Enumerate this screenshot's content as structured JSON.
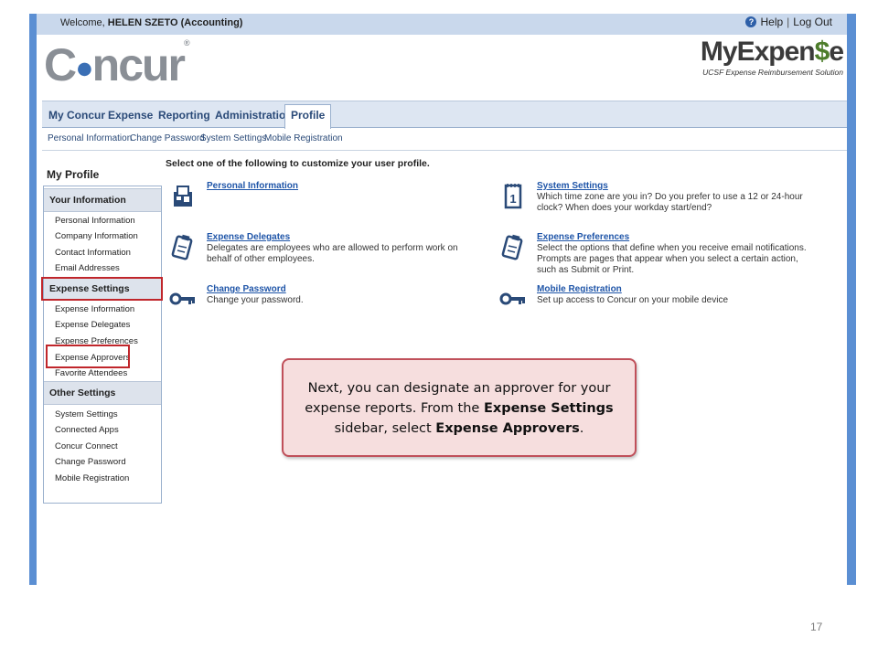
{
  "header": {
    "welcome_prefix": "Welcome,",
    "welcome_user": "HELEN SZETO (Accounting)",
    "help": "Help",
    "logout": "Log Out"
  },
  "logo": {
    "name": "C",
    "name_rest": "ncur"
  },
  "brand": {
    "title_a": "MyExpen",
    "title_s": "$",
    "title_b": "e",
    "subtitle": "UCSF Expense Reimbursement Solution"
  },
  "nav": {
    "tabs": [
      "My Concur",
      "Expense",
      "Reporting",
      "Administration",
      "Profile"
    ],
    "active": "Profile"
  },
  "subnav": [
    "Personal Information",
    "Change Password",
    "System Settings",
    "Mobile Registration"
  ],
  "sidebar": {
    "title": "My Profile",
    "sections": [
      {
        "heading": "Your Information",
        "items": [
          "Personal Information",
          "Company Information",
          "Contact Information",
          "Email Addresses"
        ]
      },
      {
        "heading": "Expense Settings",
        "items": [
          "Expense Information",
          "Expense Delegates",
          "Expense Preferences",
          "Expense Approvers",
          "Favorite Attendees"
        ]
      },
      {
        "heading": "Other Settings",
        "items": [
          "System Settings",
          "Connected Apps",
          "Concur Connect",
          "Change Password",
          "Mobile Registration"
        ]
      }
    ]
  },
  "main": {
    "instruction": "Select one of the following to customize your user profile.",
    "entries": [
      {
        "title": "Personal Information",
        "desc": "",
        "icon": "personal-info-icon"
      },
      {
        "title": "Expense Delegates",
        "desc": "Delegates are employees who are allowed to perform work on behalf of other employees.",
        "icon": "clipboard-icon"
      },
      {
        "title": "Change Password",
        "desc": "Change your password.",
        "icon": "key-icon"
      },
      {
        "title": "System Settings",
        "desc": "Which time zone are you in? Do you prefer to use a 12 or 24-hour clock? When does your workday start/end?",
        "icon": "calendar-icon"
      },
      {
        "title": "Expense Preferences",
        "desc": "Select the options that define when you receive email notifications. Prompts are pages that appear when you select a certain action, such as Submit or Print.",
        "icon": "clipboard-icon"
      },
      {
        "title": "Mobile Registration",
        "desc": "Set up access to Concur on your mobile device",
        "icon": "key-icon"
      }
    ]
  },
  "callout": {
    "part1": "Next, you can designate an approver for your expense reports. From the ",
    "bold1": "Expense Settings",
    "part2": " sidebar, select ",
    "bold2": "Expense Approvers",
    "part3": "."
  },
  "calendar_number": "1",
  "page_number": "17"
}
